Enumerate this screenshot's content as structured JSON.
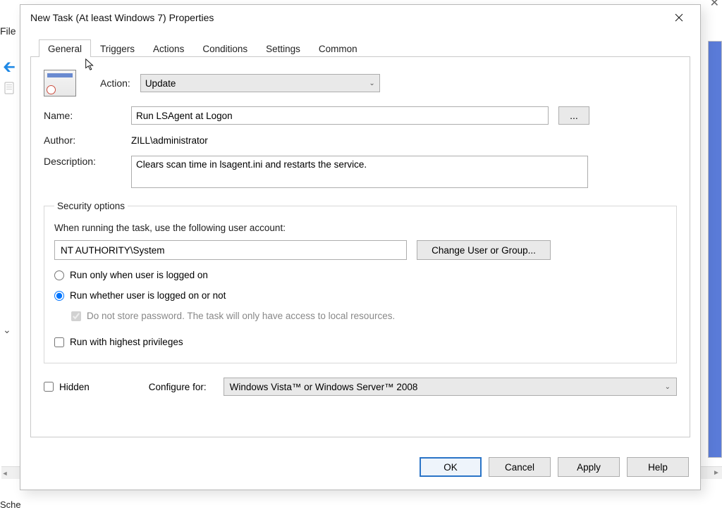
{
  "background": {
    "file_menu": "File",
    "bottom_label": "Sche"
  },
  "dialog": {
    "title": "New Task (At least Windows 7) Properties"
  },
  "tabs": {
    "general": "General",
    "triggers": "Triggers",
    "actions": "Actions",
    "conditions": "Conditions",
    "settings": "Settings",
    "common": "Common"
  },
  "general": {
    "action_label": "Action:",
    "action_value": "Update",
    "name_label": "Name:",
    "name_value": "Run LSAgent at Logon",
    "browse_button": "...",
    "author_label": "Author:",
    "author_value": "ZILL\\administrator",
    "description_label": "Description:",
    "description_value": "Clears scan time in lsagent.ini and restarts the service."
  },
  "security": {
    "legend": "Security options",
    "when_running": "When running the task, use the following user account:",
    "user_account": "NT AUTHORITY\\System",
    "change_user_btn": "Change User or Group...",
    "radio_logged_on": "Run only when user is logged on",
    "radio_whether": "Run whether user is logged on or not",
    "do_not_store_pw": "Do not store password. The task will only have access to local resources.",
    "run_highest": "Run with highest privileges"
  },
  "bottom": {
    "hidden_label": "Hidden",
    "configure_for_label": "Configure for:",
    "configure_for_value": "Windows Vista™ or Windows Server™ 2008"
  },
  "buttons": {
    "ok": "OK",
    "cancel": "Cancel",
    "apply": "Apply",
    "help": "Help"
  }
}
